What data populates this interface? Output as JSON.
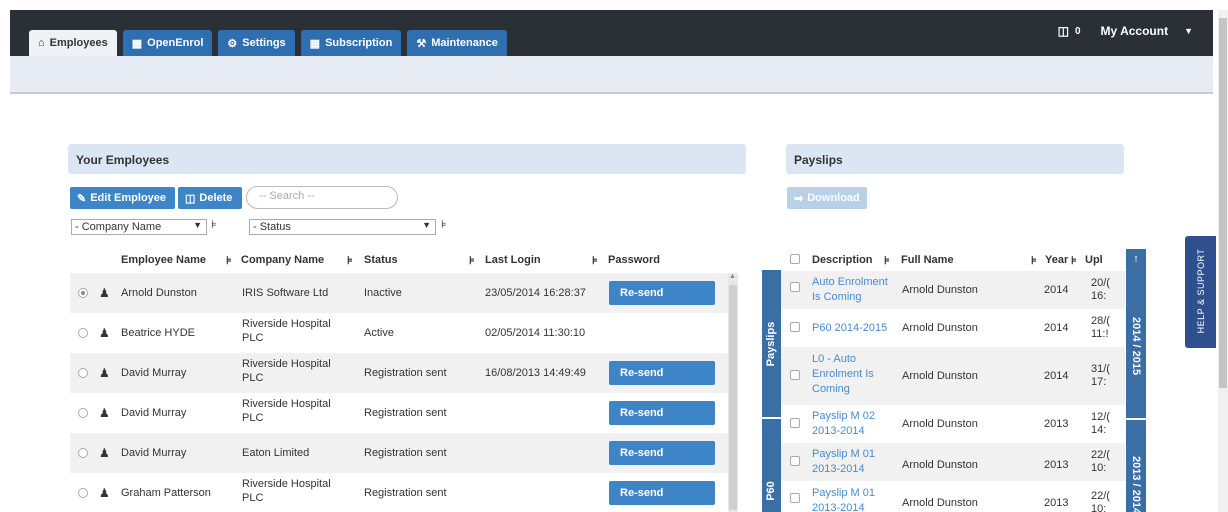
{
  "nav": {
    "tabs": [
      {
        "label": "Employees",
        "icon": "home-icon",
        "active": true
      },
      {
        "label": "OpenEnrol",
        "icon": "briefcase-icon",
        "active": false
      },
      {
        "label": "Settings",
        "icon": "gear-icon",
        "active": false
      },
      {
        "label": "Subscription",
        "icon": "table-icon",
        "active": false
      },
      {
        "label": "Maintenance",
        "icon": "wrench-icon",
        "active": false
      }
    ],
    "trash_count": "0",
    "account_label": "My Account"
  },
  "employees": {
    "panel_title": "Your Employees",
    "edit_button": "Edit Employee",
    "delete_button": "Delete",
    "search_placeholder": "-- Search --",
    "company_filter": "- Company Name",
    "status_filter": "- Status",
    "columns": [
      "Employee Name",
      "Company Name",
      "Status",
      "Last Login",
      "Password"
    ],
    "rows": [
      {
        "name": "Arnold Dunston",
        "company": "IRIS Software Ltd",
        "status": "Inactive",
        "last_login": "23/05/2014 16:28:37",
        "password": "Re-send",
        "selected": true
      },
      {
        "name": "Beatrice HYDE",
        "company": "Riverside Hospital PLC",
        "status": "Active",
        "last_login": "02/05/2014 11:30:10",
        "password": "",
        "selected": false
      },
      {
        "name": "David Murray",
        "company": "Riverside Hospital PLC",
        "status": "Registration sent",
        "last_login": "16/08/2013 14:49:49",
        "password": "Re-send",
        "selected": false
      },
      {
        "name": "David Murray",
        "company": "Riverside Hospital PLC",
        "status": "Registration sent",
        "last_login": "",
        "password": "Re-send",
        "selected": false
      },
      {
        "name": "David Murray",
        "company": "Eaton Limited",
        "status": "Registration sent",
        "last_login": "",
        "password": "Re-send",
        "selected": false
      },
      {
        "name": "Graham Patterson",
        "company": "Riverside Hospital PLC",
        "status": "Registration sent",
        "last_login": "",
        "password": "Re-send",
        "selected": false
      }
    ]
  },
  "payslips": {
    "panel_title": "Payslips",
    "download_button": "Download",
    "columns": [
      "Description",
      "Full Name",
      "Year",
      "Upl"
    ],
    "side_labels": [
      "Payslips",
      "P60"
    ],
    "year_groups": [
      "2014 / 2015",
      "2013 / 2014"
    ],
    "rows": [
      {
        "description": "Auto Enrolment Is Coming",
        "full_name": "Arnold Dunston",
        "year": "2014",
        "uploaded": "20/( 16:"
      },
      {
        "description": "P60 2014-2015",
        "full_name": "Arnold Dunston",
        "year": "2014",
        "uploaded": "28/( 11:!"
      },
      {
        "description": "L0 - Auto Enrolment Is Coming",
        "full_name": "Arnold Dunston",
        "year": "2014",
        "uploaded": "31/( 17:"
      },
      {
        "description": "Payslip M 02 2013-2014",
        "full_name": "Arnold Dunston",
        "year": "2013",
        "uploaded": "12/( 14:"
      },
      {
        "description": "Payslip M 01 2013-2014",
        "full_name": "Arnold Dunston",
        "year": "2013",
        "uploaded": "22/( 10:"
      },
      {
        "description": "Payslip M 01 2013-2014",
        "full_name": "Arnold Dunston",
        "year": "2013",
        "uploaded": "22/( 10:"
      }
    ]
  },
  "help_tab": "HELP & SUPPORT"
}
